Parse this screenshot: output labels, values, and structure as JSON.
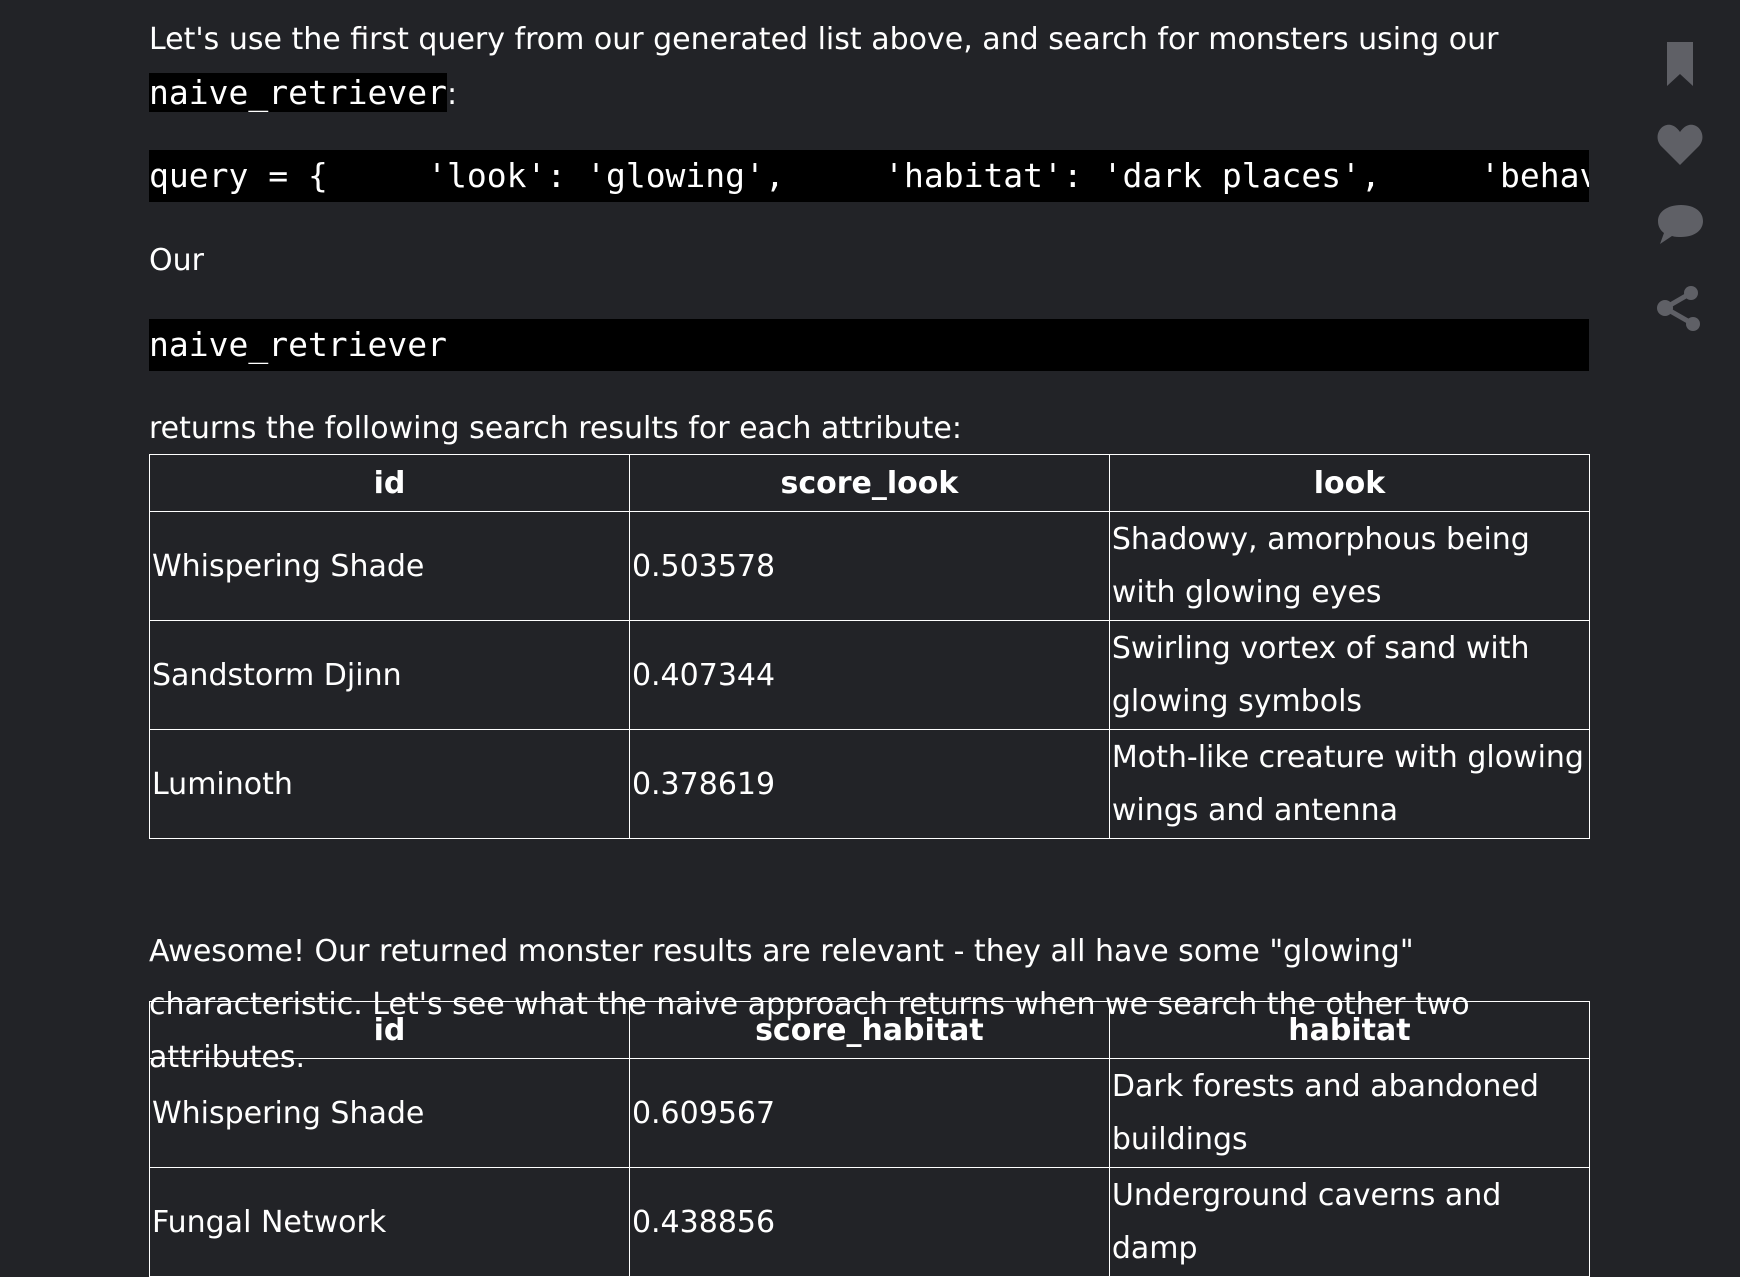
{
  "intro": {
    "text_before": "Let's use the first query from our generated list above, and search for monsters using our ",
    "code": "naive_retriever",
    "text_after": ":"
  },
  "query_code": "query = {     'look': 'glowing',     'habitat': 'dark places',     'behavior",
  "our_label": "Our",
  "retriever_code": "naive_retriever",
  "returns_text": "returns the following search results for each attribute:",
  "table_look": {
    "headers": [
      "id",
      "score_look",
      "look"
    ],
    "rows": [
      [
        "Whispering Shade",
        "0.503578",
        "Shadowy, amorphous being with glowing eyes"
      ],
      [
        "Sandstorm Djinn",
        "0.407344",
        "Swirling vortex of sand with glowing symbols"
      ],
      [
        "Luminoth",
        "0.378619",
        "Moth-like creature with glowing wings and antenna"
      ]
    ]
  },
  "awesome_text": "Awesome! Our returned monster results are relevant - they all have some \"glowing\" characteristic. Let's see what the naive approach returns when we search the other two attributes.",
  "table_habitat": {
    "headers": [
      "id",
      "score_habitat",
      "habitat"
    ],
    "rows": [
      [
        "Whispering Shade",
        "0.609567",
        "Dark forests and abandoned buildings"
      ],
      [
        "Fungal Network",
        "0.438856",
        "Underground caverns and damp"
      ]
    ]
  },
  "side_actions": {
    "icons": [
      "bookmark-icon",
      "heart-icon",
      "comment-icon",
      "share-icon"
    ],
    "color": "#5f6066"
  }
}
